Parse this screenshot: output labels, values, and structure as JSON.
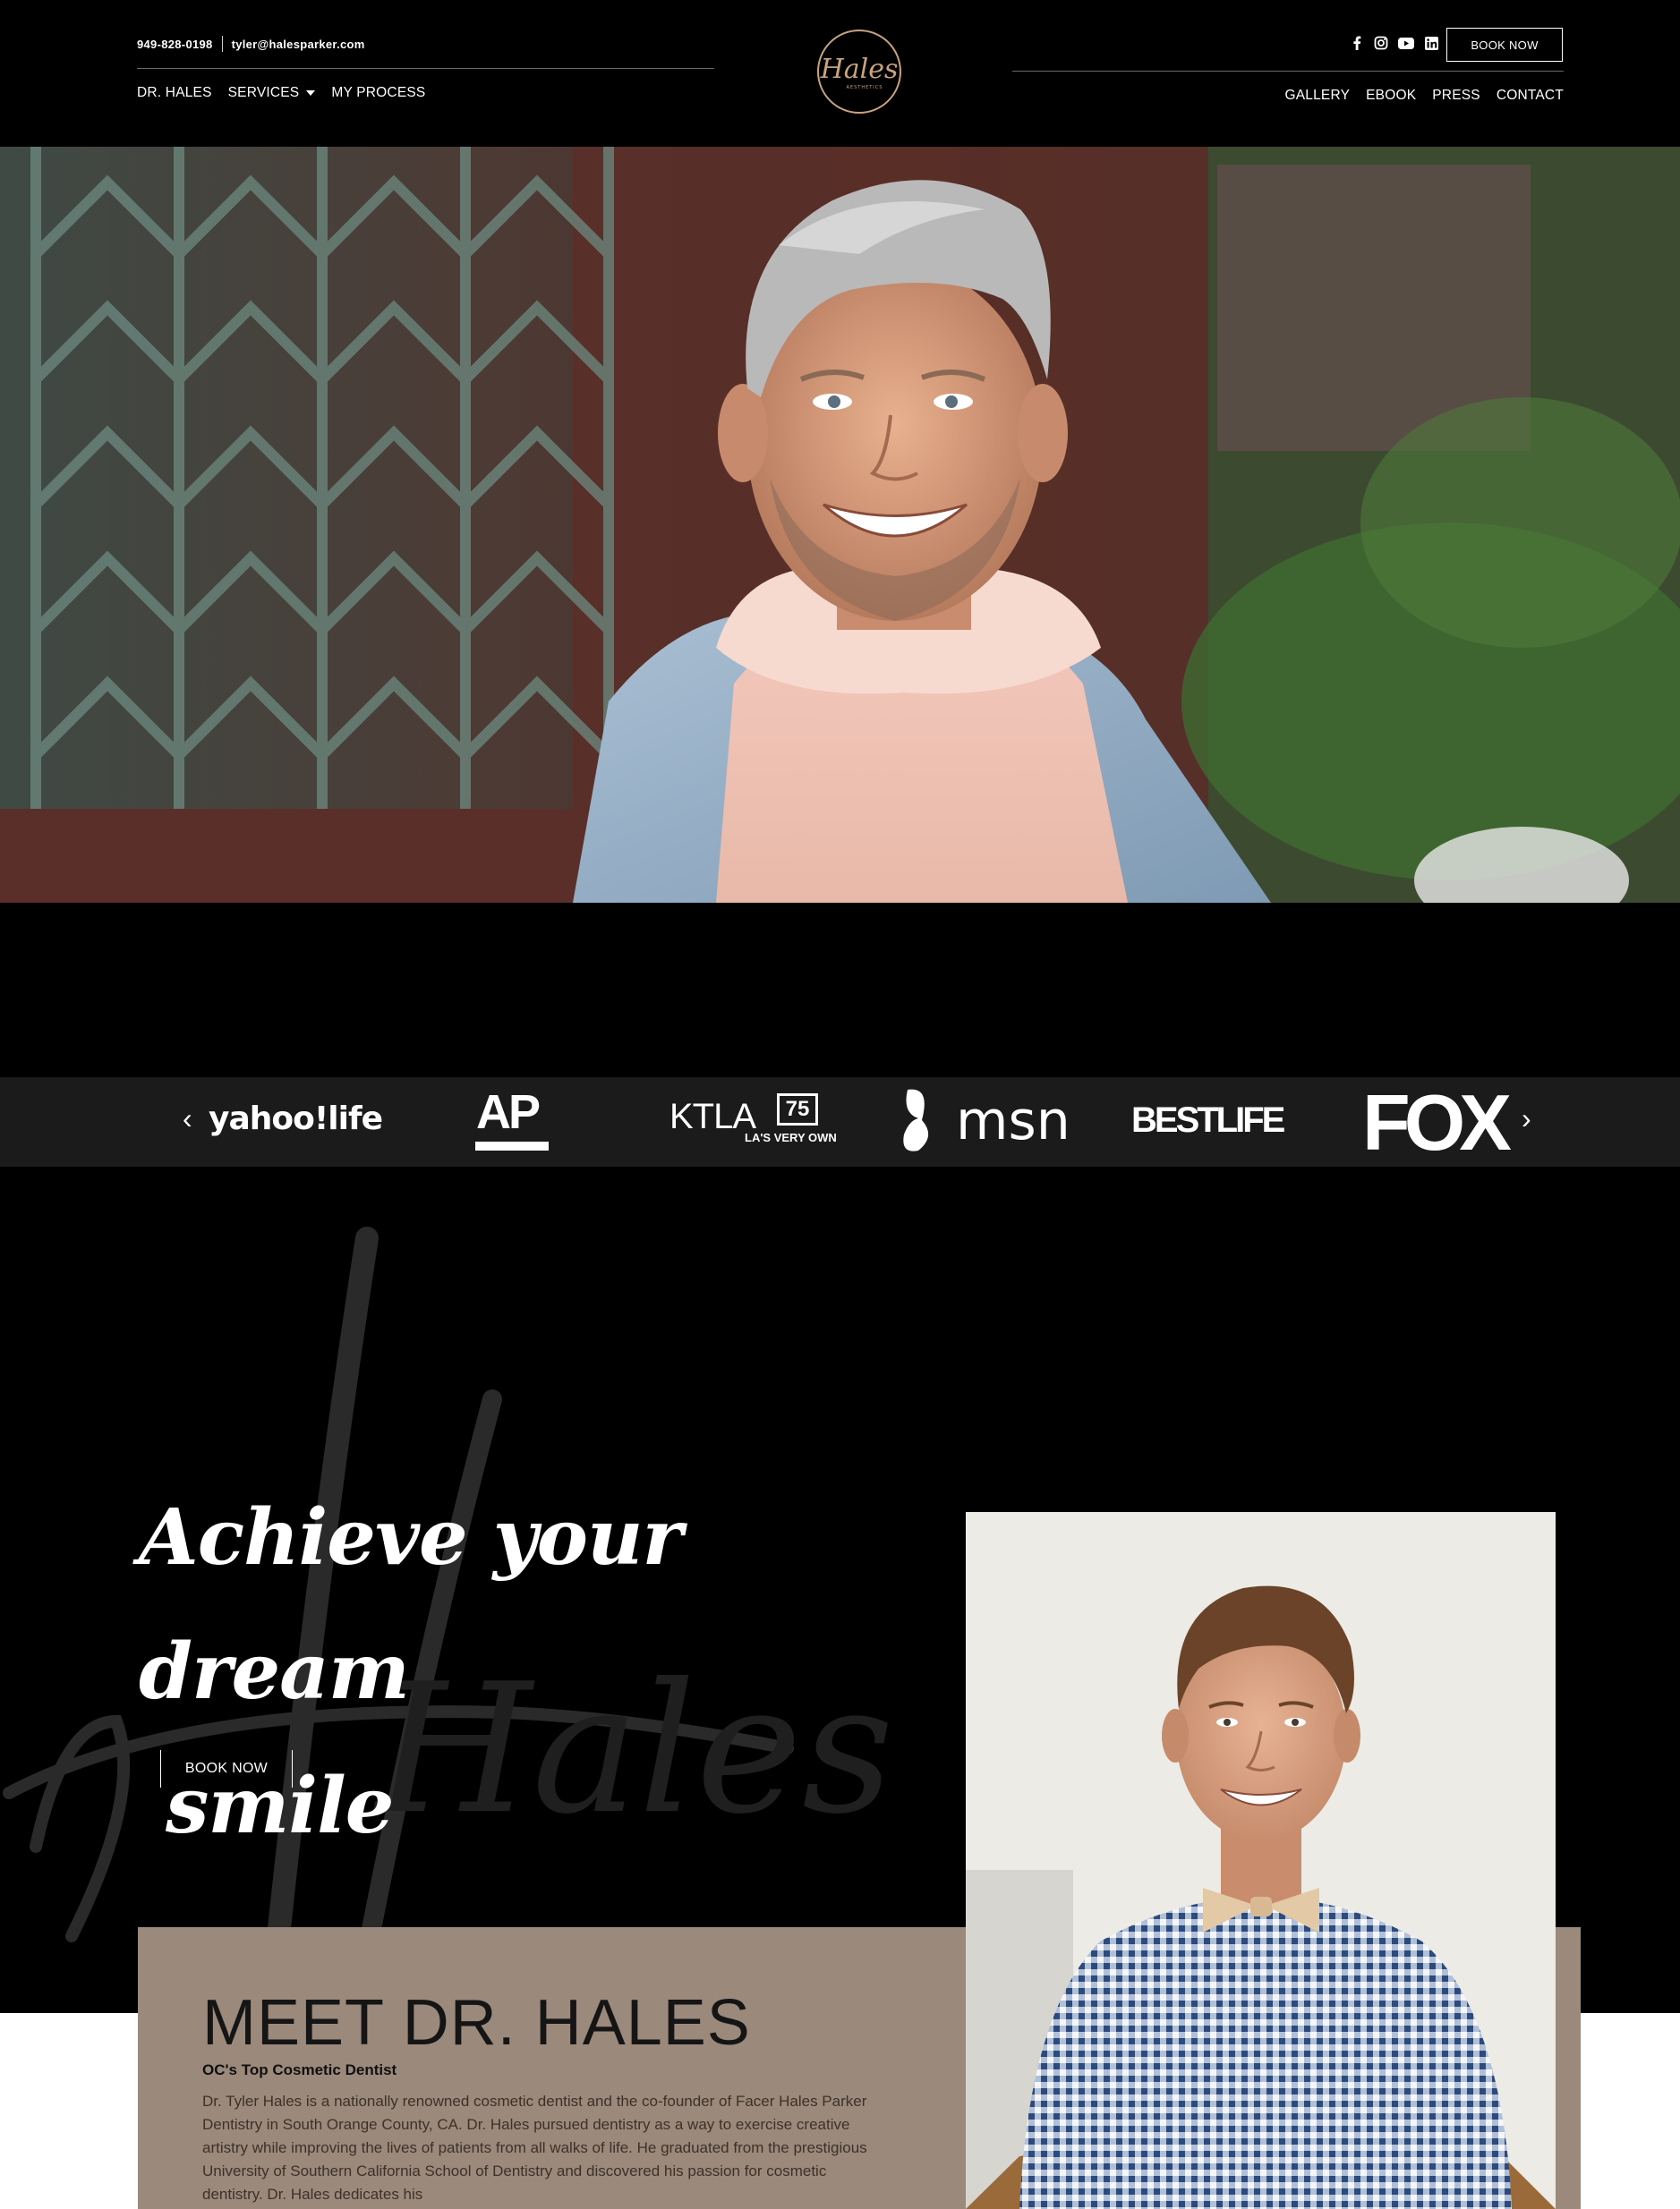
{
  "header": {
    "phone": "949-828-0198",
    "email": "tyler@halesparker.com",
    "nav_left": [
      "DR. HALES",
      "SERVICES",
      "MY PROCESS"
    ],
    "nav_right": [
      "GALLERY",
      "EBOOK",
      "PRESS",
      "CONTACT"
    ],
    "book_label": "BOOK NOW",
    "social_icons": [
      "facebook-icon",
      "instagram-icon",
      "youtube-icon",
      "linkedin-icon"
    ],
    "logo_text": "Hales",
    "logo_subtext": "AESTHETICS"
  },
  "press": {
    "logos": [
      "yahoo!life",
      "AP",
      "KTLA",
      "msn",
      "BESTLIFE",
      "FOX"
    ],
    "ktla_badge": "75",
    "ktla_tagline": "LA'S VERY OWN",
    "prev_icon": "chevron-left-icon",
    "next_icon": "chevron-right-icon"
  },
  "achieve": {
    "headline_line1": "Achieve your dream",
    "headline_line2": "smile",
    "watermark": "Hales",
    "book_label": "BOOK NOW"
  },
  "meet": {
    "title": "MEET DR. HALES",
    "subtitle": "OC's Top Cosmetic Dentist",
    "body": "Dr. Tyler Hales is a nationally renowned cosmetic dentist and the co-founder of Facer Hales Parker Dentistry in South Orange County, CA. Dr. Hales pursued dentistry as a way to exercise creative artistry while improving the lives of patients from all walks of life. He graduated from the prestigious University of Southern California School of Dentistry and discovered his passion for cosmetic dentistry. Dr. Hales dedicates his"
  },
  "colors": {
    "background": "#000000",
    "press_bar": "#1b1b1b",
    "meet_panel": "#9b8a7c",
    "logo_gold": "#c9a27e"
  }
}
